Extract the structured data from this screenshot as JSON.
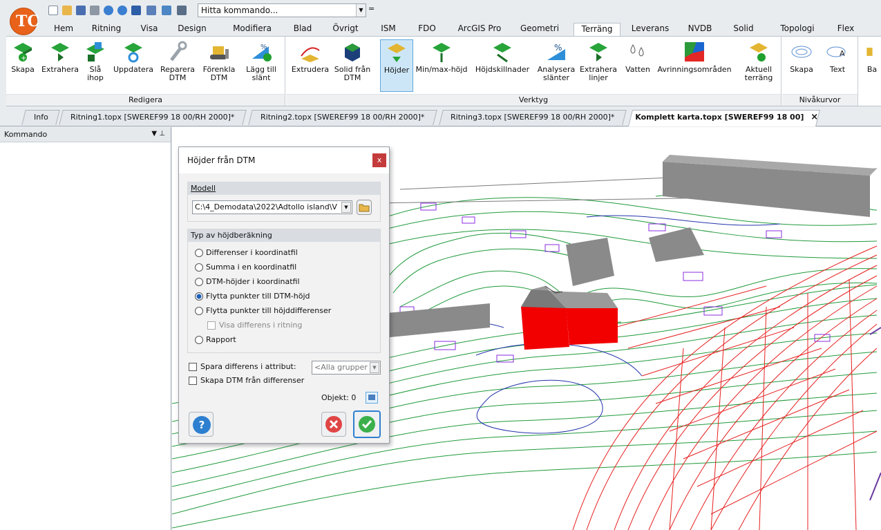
{
  "qat": {
    "search_value": "Hitta kommando...",
    "extra": "="
  },
  "tabs": [
    "Hem",
    "Ritning",
    "Visa",
    "Design",
    "Modifiera",
    "Blad",
    "Övrigt",
    "ISM",
    "FDO",
    "ArcGIS Pro",
    "Geometri",
    "Terräng",
    "Leverans",
    "NVDB",
    "Solid",
    "Topologi",
    "Flex"
  ],
  "active_tab": "Terräng",
  "ribbon": {
    "redigera": {
      "title": "Redigera",
      "buttons": [
        "Skapa",
        "Extrahera",
        "Slå ihop",
        "Uppdatera",
        "Reparera DTM",
        "Förenkla DTM",
        "Lägg till slänt"
      ]
    },
    "verktyg": {
      "title": "Verktyg",
      "buttons": [
        "Extrudera",
        "Solid från DTM",
        "Höjder",
        "Min/max-höjd",
        "Höjdskillnader",
        "Analysera slänter",
        "Extrahera linjer",
        "Vatten",
        "Avrinningsområden",
        "Aktuell terräng"
      ]
    },
    "nivakurvor": {
      "title": "Nivåkurvor",
      "buttons": [
        "Skapa",
        "Text"
      ]
    },
    "cut": "Ba"
  },
  "doc_tabs": [
    "Info",
    "Ritning1.topx [SWEREF99 18 00/RH 2000]*",
    "Ritning2.topx [SWEREF99 18 00/RH 2000]*",
    "Ritning3.topx [SWEREF99 18 00/RH 2000]*",
    "Komplett karta.topx [SWEREF99 18 00]"
  ],
  "doc_close": "×",
  "command_panel": {
    "title": "Kommando",
    "pins": "▼ ⊥"
  },
  "dialog": {
    "title": "Höjder från DTM",
    "close": "x",
    "model_label": "Modell",
    "model_value": "C:\\4_Demodata\\2022\\Adtollo island\\V",
    "type_label": "Typ av höjdberäkning",
    "options": [
      "Differenser i koordinatfil",
      "Summa i en koordinatfil",
      "DTM-höjder i koordinatfil",
      "Flytta punkter till DTM-höjd",
      "Flytta punkter till höjddifferenser",
      "Rapport"
    ],
    "selected_option": "Flytta punkter till DTM-höjd",
    "sub_option": "Visa differens i ritning",
    "save_diff": "Spara differens i attribut:",
    "group_value": "<Alla grupper",
    "create_dtm": "Skapa DTM från differenser",
    "objekt": "Objekt: 0",
    "help": "?"
  },
  "colors": {
    "accent": "#1d5fb8",
    "logo": "#e8621a",
    "building_red": "#f20000",
    "contour_green": "#1f9a3a",
    "road_red": "#e61e1e",
    "blue": "#2233aa",
    "purple": "#8a2be2"
  }
}
